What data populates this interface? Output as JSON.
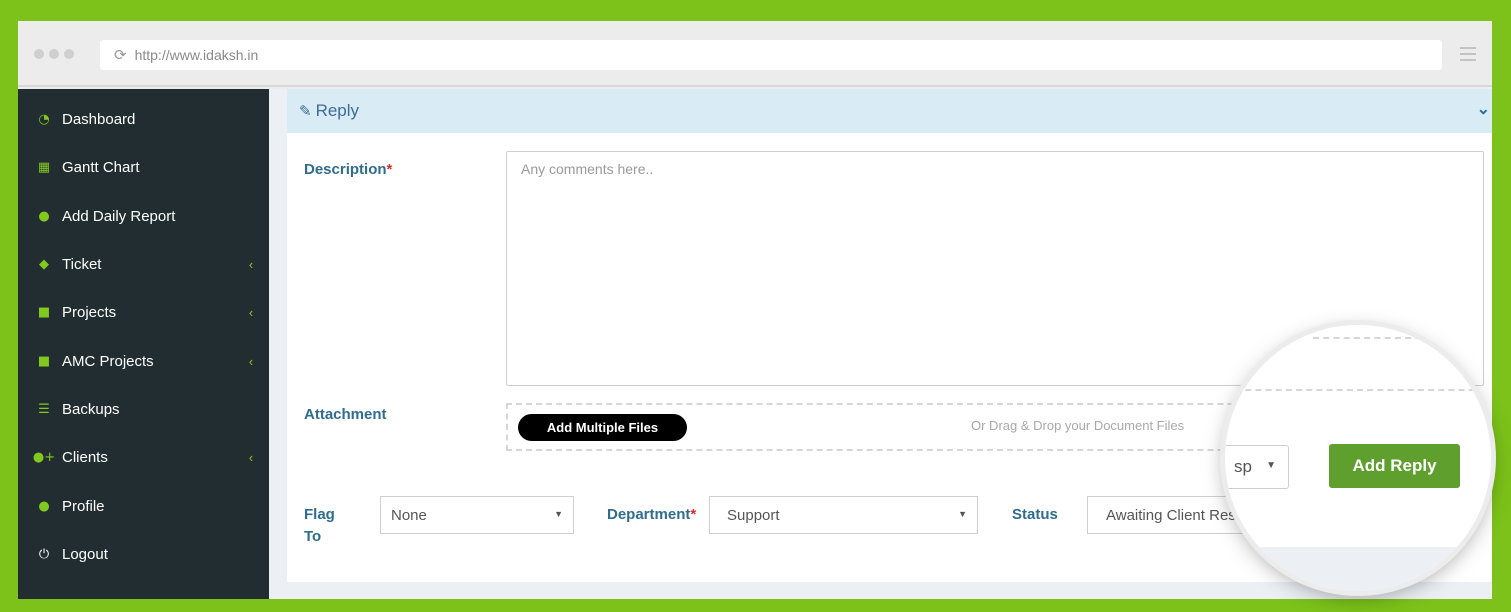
{
  "browser": {
    "url": "http://www.idaksh.in"
  },
  "sidebar": {
    "items": [
      {
        "label": "Dashboard",
        "icon": "dashboard-icon",
        "has_children": false
      },
      {
        "label": "Gantt Chart",
        "icon": "calendar-icon",
        "has_children": false
      },
      {
        "label": "Add Daily Report",
        "icon": "user-icon",
        "has_children": false
      },
      {
        "label": "Ticket",
        "icon": "ticket-icon",
        "has_children": true
      },
      {
        "label": "Projects",
        "icon": "file-icon",
        "has_children": true
      },
      {
        "label": "AMC Projects",
        "icon": "file-icon",
        "has_children": true
      },
      {
        "label": "Backups",
        "icon": "database-icon",
        "has_children": false
      },
      {
        "label": "Clients",
        "icon": "user-plus-icon",
        "has_children": true
      },
      {
        "label": "Profile",
        "icon": "user-icon",
        "has_children": false
      },
      {
        "label": "Logout",
        "icon": "power-icon",
        "has_children": false
      }
    ],
    "chevron": "‹"
  },
  "reply": {
    "header": "Reply",
    "description_label": "Description",
    "required_mark": "*",
    "description_placeholder": "Any comments here..",
    "attachment_label": "Attachment",
    "add_files_label": "Add Multiple Files",
    "drop_hint": "Or Drag & Drop your Document Files",
    "flag_label_1": "Flag",
    "flag_label_2": "To",
    "flag_value": "None",
    "department_label": "Department",
    "department_value": "Support",
    "status_label": "Status",
    "status_value": "Awaiting Client Res",
    "add_reply_label": "Add Reply",
    "magnified_select_value": "sp"
  },
  "colors": {
    "brand_green": "#7cc21a",
    "sidebar_bg": "#222d32",
    "header_bg": "#d9ecf6",
    "add_reply_bg": "#5e9f2e"
  }
}
